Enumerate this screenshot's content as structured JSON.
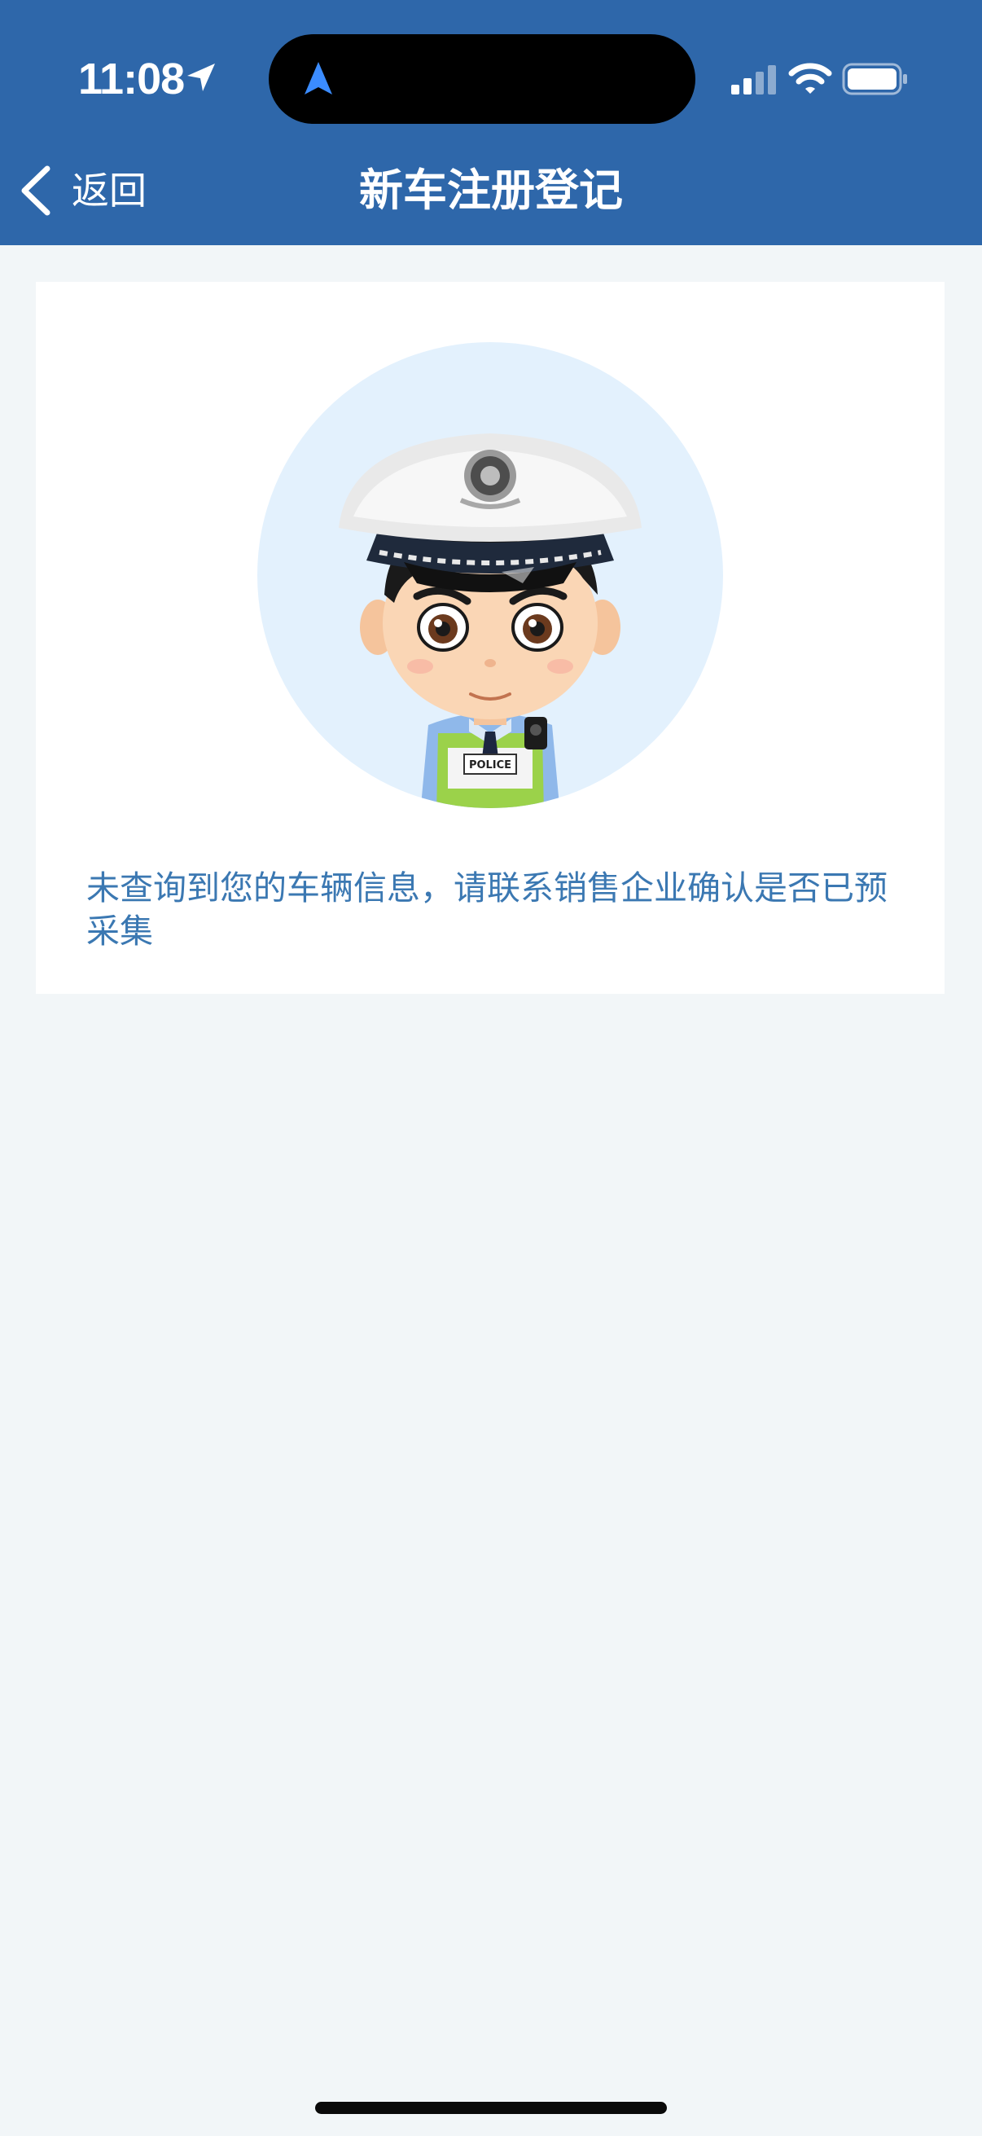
{
  "status_bar": {
    "time": "11:08",
    "icons": [
      "location-arrow-icon",
      "navigation-arrow-icon",
      "cellular-signal-icon",
      "wifi-icon",
      "battery-icon"
    ]
  },
  "header": {
    "back_label": "返回",
    "title": "新车注册登记",
    "background_color": "#2e67aa"
  },
  "card": {
    "avatar_badge_text": "POLICE",
    "message": "未查询到您的车辆信息，请联系销售企业确认是否已预采集",
    "message_color": "#3b78b2"
  },
  "colors": {
    "page_background": "#f2f6f8",
    "avatar_circle": "#e3f1fd"
  }
}
